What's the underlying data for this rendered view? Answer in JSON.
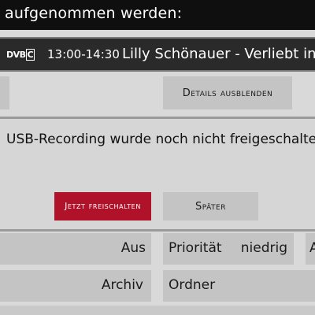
{
  "header": {
    "title": "aufgenommen werden:"
  },
  "epg": {
    "channel_logo": "DVB-C",
    "time": "13:00-14:30",
    "program": "Lilly Schönauer - Verliebt in ein"
  },
  "details_button": {
    "label": "Details ausblenden"
  },
  "dialog": {
    "message": "USB-Recording wurde noch nicht freigeschaltet!",
    "unlock_button": "Jetzt freischalten",
    "later_button": "Später"
  },
  "settings": {
    "row1": {
      "value_left": "Aus",
      "label": "Priorität",
      "value": "niedrig",
      "cut": "A"
    },
    "row2": {
      "value_left": "Archiv",
      "label": "Ordner"
    }
  },
  "colors": {
    "accent": "#b0122a",
    "bar": "#0f0f0f"
  }
}
